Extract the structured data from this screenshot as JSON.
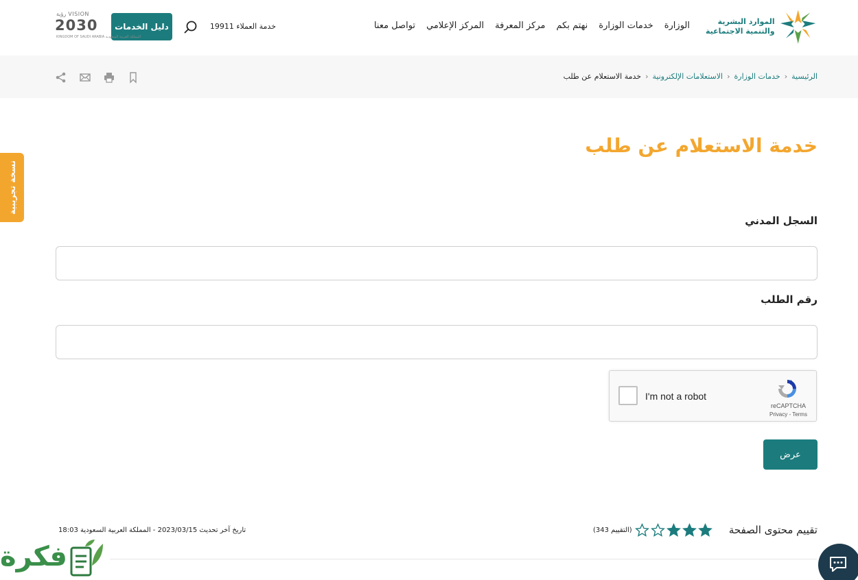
{
  "header": {
    "logo_line1": "الموارد البشرية",
    "logo_line2": "والتنمية الاجتماعية",
    "nav": [
      "الوزارة",
      "خدمات الوزارة",
      "نهتم بكم",
      "مركز المعرفة",
      "المركز الإعلامي",
      "تواصل معنا"
    ],
    "hotline": "خدمة العملاء 19911",
    "guide_button": "دليل الخدمات",
    "vision_top": "VISION رؤية",
    "vision_year": "2030",
    "vision_sub": "المملكة العربية السعودية KINGDOM OF SAUDI ARABIA"
  },
  "breadcrumb": {
    "items": [
      "الرئيسية",
      "خدمات الوزارة",
      "الاستعلامات الإلكترونية"
    ],
    "current": "خدمة الاستعلام عن طلب"
  },
  "beta_tab": "نسخة تجريبية",
  "page_title": "خدمة الاستعلام عن طلب",
  "form": {
    "civil_label": "السجل المدني",
    "civil_value": "",
    "request_label": "رقم الطلب",
    "request_value": "",
    "submit": "عرض"
  },
  "captcha": {
    "text": "I'm not a robot",
    "brand": "reCAPTCHA",
    "links": "Privacy - Terms"
  },
  "rating": {
    "label": "تقييم محتوى الصفحة",
    "stars_filled": 3,
    "stars_total": 5,
    "count_text": "(التقييم 343)"
  },
  "updated": "تاريخ آخر تحديث 2023/03/15 - المملكة العربية السعودية 18:03",
  "watermark": "فكرة",
  "colors": {
    "primary": "#1c7c7d",
    "accent": "#f3a62e",
    "chat": "#1e3b4d"
  }
}
